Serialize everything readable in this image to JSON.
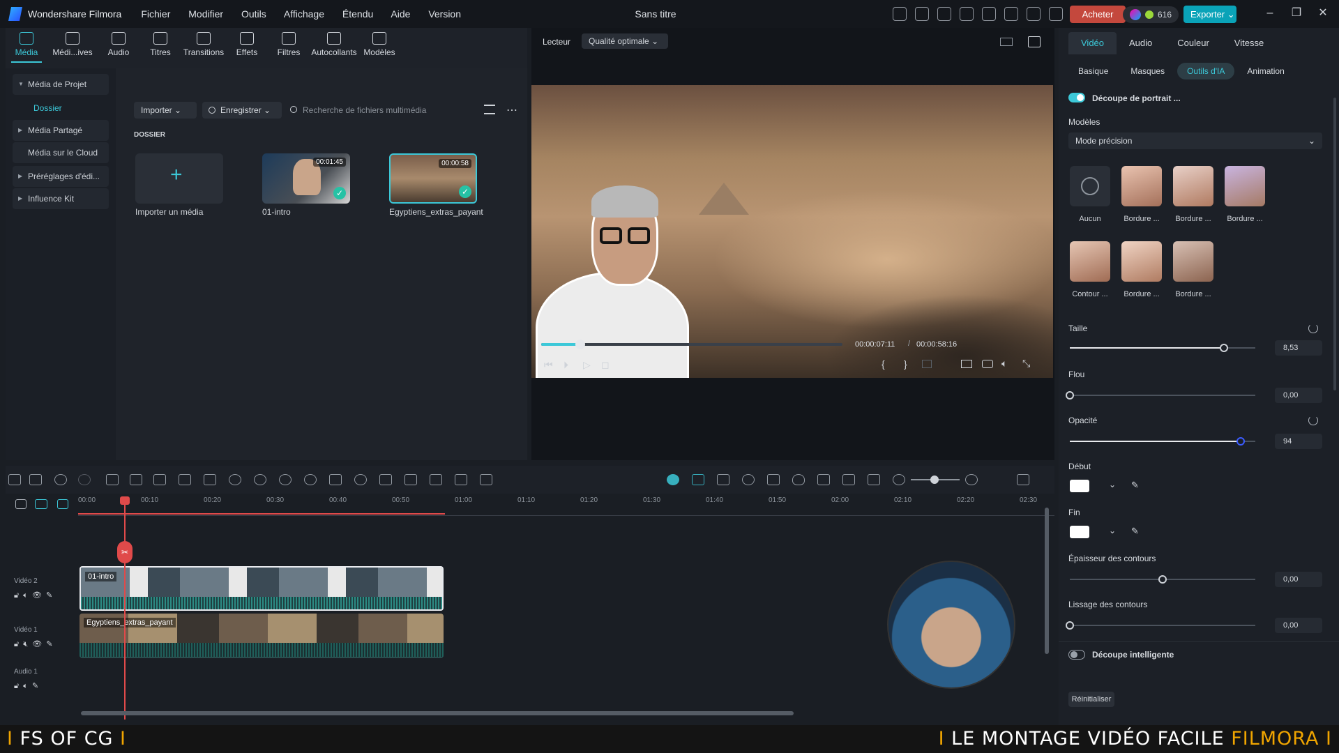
{
  "titlebar": {
    "app_name": "Wondershare Filmora",
    "menu": [
      "Fichier",
      "Modifier",
      "Outils",
      "Affichage",
      "Étendu",
      "Aide",
      "Version"
    ],
    "document_title": "Sans titre",
    "buy_label": "Acheter",
    "credits": "616",
    "export_label": "Exporter"
  },
  "media_tabs": [
    {
      "label": "Média",
      "icon": "media-icon"
    },
    {
      "label": "Médi...ives",
      "icon": "stock-media-icon"
    },
    {
      "label": "Audio",
      "icon": "music-note-icon"
    },
    {
      "label": "Titres",
      "icon": "text-icon"
    },
    {
      "label": "Transitions",
      "icon": "transition-icon"
    },
    {
      "label": "Effets",
      "icon": "effects-icon"
    },
    {
      "label": "Filtres",
      "icon": "filter-icon"
    },
    {
      "label": "Autocollants",
      "icon": "sticker-icon"
    },
    {
      "label": "Modèles",
      "icon": "template-icon"
    }
  ],
  "media_sidebar": {
    "project_media": "Média de Projet",
    "folder": "Dossier",
    "shared_media": "Média Partagé",
    "cloud_media": "Média sur le Cloud",
    "presets": "Préréglages d'édi...",
    "influence_kit": "Influence Kit"
  },
  "media_toolbar": {
    "import": "Importer",
    "record": "Enregistrer",
    "search_placeholder": "Recherche de fichiers multimédia"
  },
  "media_section": "DOSSIER",
  "media_items": [
    {
      "label": "Importer un média"
    },
    {
      "label": "01-intro",
      "duration": "00:01:45"
    },
    {
      "label": "Egyptiens_extras_payant",
      "duration": "00:00:58"
    }
  ],
  "preview": {
    "player_label": "Lecteur",
    "quality": "Qualité optimale",
    "current_time": "00:00:07:11",
    "separator": "/",
    "total_time": "00:00:58:16",
    "progress": 0.13
  },
  "timeline": {
    "ticks": [
      "00:00",
      "00:10",
      "00:20",
      "00:30",
      "00:40",
      "00:50",
      "01:00",
      "01:10",
      "01:20",
      "01:30",
      "01:40",
      "01:50",
      "02:00",
      "02:10",
      "02:20",
      "02:30"
    ],
    "tracks": [
      {
        "label": "Vidéo 2",
        "clip": "01-intro"
      },
      {
        "label": "Vidéo 1",
        "clip": "Egyptiens_extras_payant"
      },
      {
        "label": "Audio 1",
        "clip": ""
      }
    ]
  },
  "props": {
    "tabs": [
      "Vidéo",
      "Audio",
      "Couleur",
      "Vitesse"
    ],
    "subtabs": [
      "Basique",
      "Masques",
      "Outils d'IA",
      "Animation"
    ],
    "portrait_cut": "Découpe de portrait ...",
    "models_label": "Modèles",
    "models_value": "Mode précision",
    "presets": [
      "Aucun",
      "Bordure ...",
      "Bordure ...",
      "Bordure ...",
      "Contour ...",
      "Bordure ...",
      "Bordure ..."
    ],
    "size_label": "Taille",
    "size_value": "8,53",
    "size_level": 0.83,
    "blur_label": "Flou",
    "blur_value": "0,00",
    "blur_level": 0,
    "opacity_label": "Opacité",
    "opacity_value": "94",
    "opacity_level": 0.92,
    "start_label": "Début",
    "end_label": "Fin",
    "edge_thickness_label": "Épaisseur des contours",
    "edge_thickness_value": "0,00",
    "edge_thickness_level": 0.5,
    "edge_smooth_label": "Lissage des contours",
    "edge_smooth_value": "0,00",
    "edge_smooth_level": 0,
    "smart_cut": "Découpe intelligente",
    "reset": "Réinitialiser"
  },
  "banner": {
    "left": "FS OF CG",
    "right_main": "LE MONTAGE VIDÉO FACILE",
    "right_accent": "FILMORA"
  }
}
